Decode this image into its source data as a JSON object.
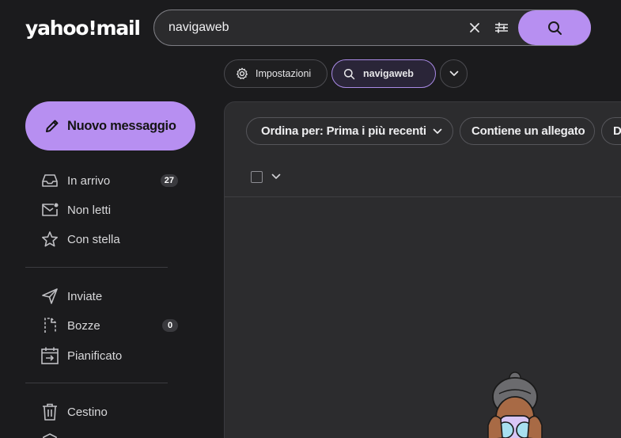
{
  "app": {
    "logo": "yahoo!mail"
  },
  "search": {
    "query": "navigaweb"
  },
  "chips": {
    "settings": "Impostazioni",
    "query": "navigaweb"
  },
  "compose": {
    "label": "Nuovo messaggio"
  },
  "nav": {
    "group1": [
      {
        "label": "In arrivo",
        "icon": "inbox-icon",
        "badge": "27"
      },
      {
        "label": "Non letti",
        "icon": "unread-mail-icon",
        "badge": ""
      },
      {
        "label": "Con stella",
        "icon": "star-icon",
        "badge": ""
      }
    ],
    "group2": [
      {
        "label": "Inviate",
        "icon": "send-icon",
        "badge": ""
      },
      {
        "label": "Bozze",
        "icon": "draft-icon",
        "badge": "0"
      },
      {
        "label": "Pianificato",
        "icon": "scheduled-icon",
        "badge": ""
      }
    ],
    "group3": [
      {
        "label": "Cestino",
        "icon": "trash-icon",
        "badge": ""
      }
    ]
  },
  "filters": {
    "sort": "Ordina per: Prima i più recenti",
    "attachment": "Contiene un allegato",
    "cut": "D"
  },
  "colors": {
    "accent": "#b78ff1",
    "background": "#1b1b1d",
    "panel": "#2c2c2e"
  }
}
